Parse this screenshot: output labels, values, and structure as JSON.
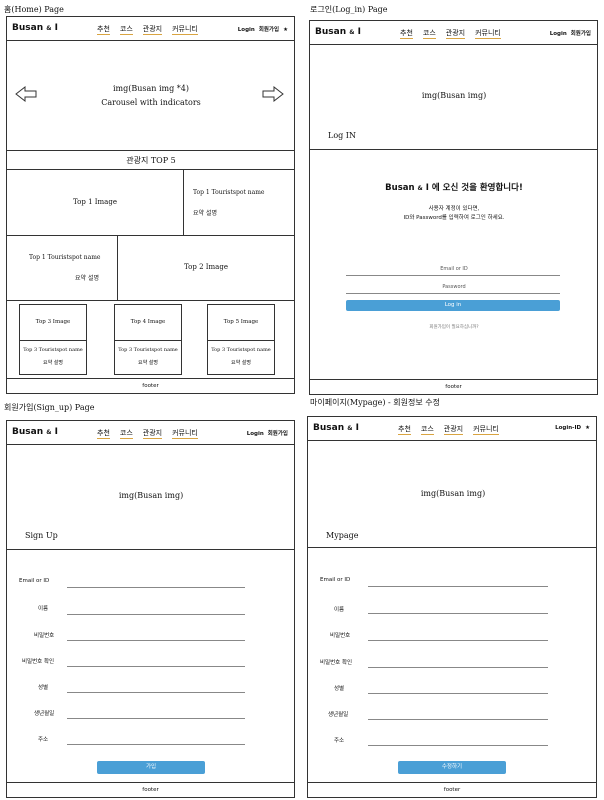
{
  "captions": {
    "home": "홈(Home) Page",
    "login": "로그인(Log_in) Page",
    "signup": "회원가입(Sign_up) Page",
    "mypage": "마이페이지(Mypage) - 회원정보 수정"
  },
  "nav": {
    "logo_main": "Busan",
    "logo_amp": "&",
    "logo_end": "I",
    "menu": [
      "추천",
      "코스",
      "관광지",
      "커뮤니티"
    ],
    "login": "Login",
    "signup": "회원가입",
    "star": "★",
    "login_id": "Login-ID"
  },
  "home": {
    "carousel_title": "img(Busan img *4)",
    "carousel_sub": "Carousel with indicators",
    "top5_title": "관광지 TOP 5",
    "top1_image": "Top 1 Image",
    "top1_name": "Top 1 Touristspot name",
    "top1_summary": "요약 설명",
    "top1b_name": "Top 1 Touristspot name",
    "top1b_summary": "요약 설명",
    "top2_image": "Top 2 Image",
    "top3_image": "Top 3 Image",
    "top3_name": "Top 3 Touristspot name",
    "top3_summary": "요약 설명",
    "top4_image": "Top 4 Image",
    "top4_name": "Top 3 Touristspot name",
    "top4_summary": "요약 설명",
    "top5_image": "Top 5 Image",
    "top5_name": "Top 3 Touristspot name",
    "top5_summary": "요약 설명",
    "footer": "footer"
  },
  "login": {
    "banner": "img(Busan img)",
    "heading": "Log IN",
    "welcome_a": "Busan",
    "welcome_amp": "&",
    "welcome_b": "I 에 오신 것을 환영합니다!",
    "desc1": "사용자 계정이 있다면,",
    "desc2": "ID와 Password를 입력하여 로그인 하세요.",
    "email_placeholder": "Email or ID",
    "password_placeholder": "Password",
    "button": "Log in",
    "signup_link": "회원가입이 필요하십니까?",
    "footer": "footer"
  },
  "signup": {
    "banner": "img(Busan img)",
    "heading": "Sign Up",
    "fields": [
      "Email or ID",
      "이름",
      "비밀번호",
      "비밀번호 확인",
      "성별",
      "생년월일",
      "주소"
    ],
    "button": "가입",
    "footer": "footer"
  },
  "mypage": {
    "banner": "img(Busan img)",
    "heading": "Mypage",
    "fields": [
      "Email or ID",
      "이름",
      "비밀번호",
      "비밀번호 확인",
      "성별",
      "생년월일",
      "주소"
    ],
    "button": "수정하기",
    "footer": "footer"
  }
}
